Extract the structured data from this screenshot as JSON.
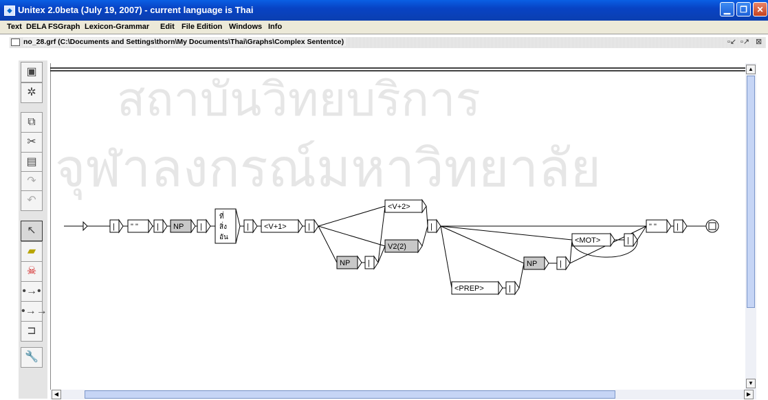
{
  "window": {
    "title": "Unitex 2.0beta (July 19, 2007) - current language is Thai",
    "controls": [
      "minimize-icon",
      "maximize-icon",
      "close-icon"
    ]
  },
  "menu": [
    "Text",
    "DELA",
    "FSGraph",
    "Lexicon-Grammar",
    "Edit",
    "File Edition",
    "Windows",
    "Info"
  ],
  "document": {
    "title": "no_28.grf (C:\\Documents and Settings\\thorn\\My Documents\\Thai\\Graphs\\Complex Sententce)"
  },
  "toolbar": {
    "icons": [
      "save-icon",
      "compile-icon",
      "copy-icon",
      "cut-icon",
      "paste-icon",
      "redo-icon",
      "undo-icon",
      "arrow-icon",
      "open-box-icon",
      "kill-icon",
      "link-icon",
      "reverse-link-icon",
      "box-icon",
      "configure-icon"
    ]
  },
  "graph": {
    "boxes": {
      "quote1": "\" \"",
      "np1": "NP",
      "thai_line1": "ที่",
      "thai_line2": "สิ่ง",
      "thai_line3": "อัน",
      "v1": "<V+1>",
      "v2plus": "<V+2>",
      "v2sub": "V2(2)",
      "np2": "NP",
      "prep": "<PREP>",
      "np3": "NP",
      "mot": "<MOT>",
      "quote2": "\" \"",
      "sep": "|"
    }
  },
  "watermark": {
    "line1": "สถาบันวิทยบริการ",
    "line2": "จุฬาลงกรณ์มหาวิทยาลัย"
  }
}
